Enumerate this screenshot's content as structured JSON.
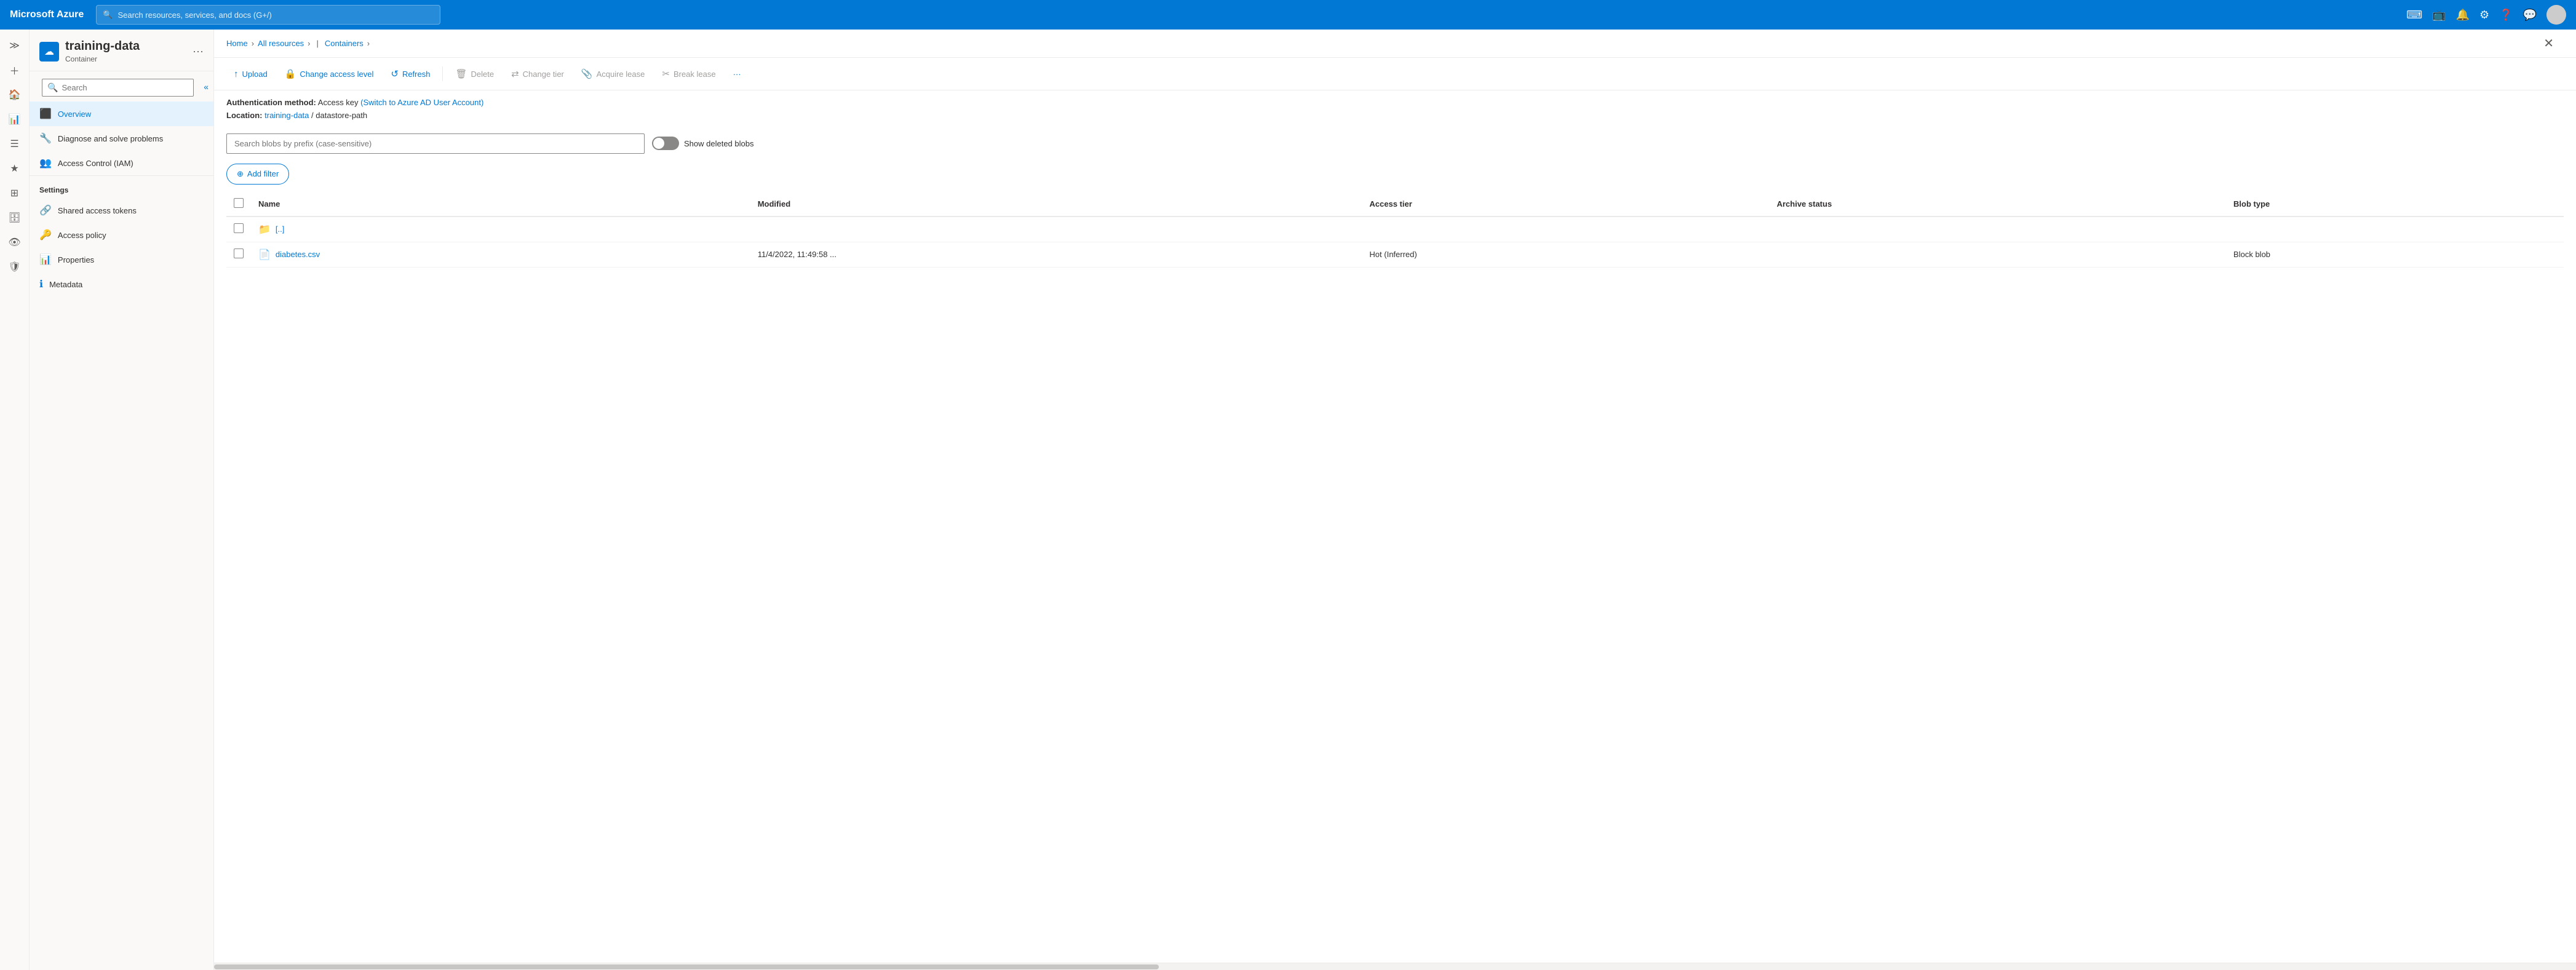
{
  "topNav": {
    "brand": "Microsoft Azure",
    "searchPlaceholder": "Search resources, services, and docs (G+/)",
    "icons": [
      "terminal-icon",
      "cloud-upload-icon",
      "bell-icon",
      "settings-icon",
      "help-icon",
      "person-icon"
    ]
  },
  "breadcrumb": {
    "home": "Home",
    "allResources": "All resources",
    "containers": "Containers",
    "pipe": "|"
  },
  "resource": {
    "name": "training-data",
    "subtitle": "Container",
    "moreLabel": "···"
  },
  "navSearch": {
    "placeholder": "Search",
    "collapseIcon": "«"
  },
  "navItems": [
    {
      "id": "overview",
      "label": "Overview",
      "icon": "⊞",
      "active": true
    },
    {
      "id": "diagnose",
      "label": "Diagnose and solve problems",
      "icon": "🔧",
      "active": false
    },
    {
      "id": "iam",
      "label": "Access Control (IAM)",
      "icon": "👥",
      "active": false
    }
  ],
  "navSettings": {
    "sectionLabel": "Settings",
    "items": [
      {
        "id": "shared-access",
        "label": "Shared access tokens",
        "icon": "🔗"
      },
      {
        "id": "access-policy",
        "label": "Access policy",
        "icon": "🔑"
      },
      {
        "id": "properties",
        "label": "Properties",
        "icon": "📊"
      },
      {
        "id": "metadata",
        "label": "Metadata",
        "icon": "ℹ"
      }
    ]
  },
  "toolbar": {
    "upload": "Upload",
    "changeAccessLevel": "Change access level",
    "refresh": "Refresh",
    "delete": "Delete",
    "changeTier": "Change tier",
    "acquireLease": "Acquire lease",
    "breakLease": "Break lease",
    "more": "···"
  },
  "authInfo": {
    "label": "Authentication method:",
    "method": "Access key",
    "switchLink": "(Switch to Azure AD User Account)",
    "locationLabel": "Location:",
    "locationPath": "training-data",
    "locationSlash": "/",
    "locationSub": "datastore-path"
  },
  "blobSearch": {
    "placeholder": "Search blobs by prefix (case-sensitive)",
    "showDeletedLabel": "Show deleted blobs"
  },
  "addFilter": {
    "label": "Add filter",
    "icon": "⊕"
  },
  "table": {
    "columns": [
      {
        "id": "checkbox",
        "label": ""
      },
      {
        "id": "name",
        "label": "Name"
      },
      {
        "id": "modified",
        "label": "Modified"
      },
      {
        "id": "accessTier",
        "label": "Access tier"
      },
      {
        "id": "archiveStatus",
        "label": "Archive status"
      },
      {
        "id": "blobType",
        "label": "Blob type"
      }
    ],
    "rows": [
      {
        "type": "folder",
        "name": "[..]",
        "modified": "",
        "accessTier": "",
        "archiveStatus": "",
        "blobType": ""
      },
      {
        "type": "file",
        "name": "diabetes.csv",
        "modified": "11/4/2022, 11:49:58 ...",
        "accessTier": "Hot (Inferred)",
        "archiveStatus": "",
        "blobType": "Block blob"
      }
    ]
  },
  "icons": {
    "search": "🔍",
    "terminal": "⌨",
    "bell": "🔔",
    "settings": "⚙",
    "help": "❓",
    "upload": "↑",
    "lock": "🔒",
    "refresh": "↺",
    "delete": "🗑",
    "changeTier": "⇄",
    "lease": "📎",
    "breakLease": "✂",
    "folder": "📁",
    "file": "📄",
    "close": "✕",
    "addFilter": "⊕",
    "home": "🏠",
    "overview": "⬛",
    "wrench": "🔧",
    "users": "👥",
    "link": "🔗",
    "key": "🔑",
    "props": "⊟",
    "info": "ℹ"
  }
}
